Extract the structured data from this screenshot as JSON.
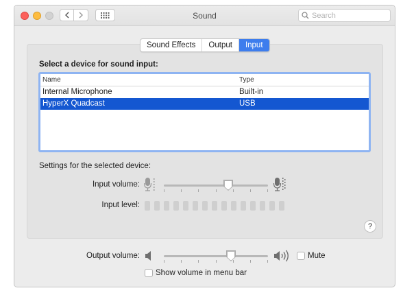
{
  "window": {
    "title": "Sound"
  },
  "search": {
    "placeholder": "Search"
  },
  "tabs": [
    {
      "label": "Sound Effects",
      "active": false
    },
    {
      "label": "Output",
      "active": false
    },
    {
      "label": "Input",
      "active": true
    }
  ],
  "input": {
    "section_title": "Select a device for sound input:",
    "columns": {
      "name": "Name",
      "type": "Type"
    },
    "devices": [
      {
        "name": "Internal Microphone",
        "type": "Built-in",
        "selected": false
      },
      {
        "name": "HyperX Quadcast",
        "type": "USB",
        "selected": true
      }
    ],
    "settings_label": "Settings for the selected device:",
    "volume_label": "Input volume:",
    "volume_fraction": 0.63,
    "level_label": "Input level:",
    "level_segments": 15,
    "level_fraction": 0
  },
  "output": {
    "volume_label": "Output volume:",
    "volume_fraction": 0.66,
    "mute_label": "Mute",
    "mute_checked": false,
    "menubar_label": "Show volume in menu bar",
    "menubar_checked": false
  },
  "help": {
    "label": "?"
  },
  "icons": {
    "back": "chevron-left-icon",
    "forward": "chevron-right-icon",
    "show_all": "grid-icon",
    "search": "search-icon",
    "mic_low": "microphone-low-icon",
    "mic_high": "microphone-high-icon",
    "speaker_low": "speaker-low-icon",
    "speaker_high": "speaker-high-icon"
  }
}
